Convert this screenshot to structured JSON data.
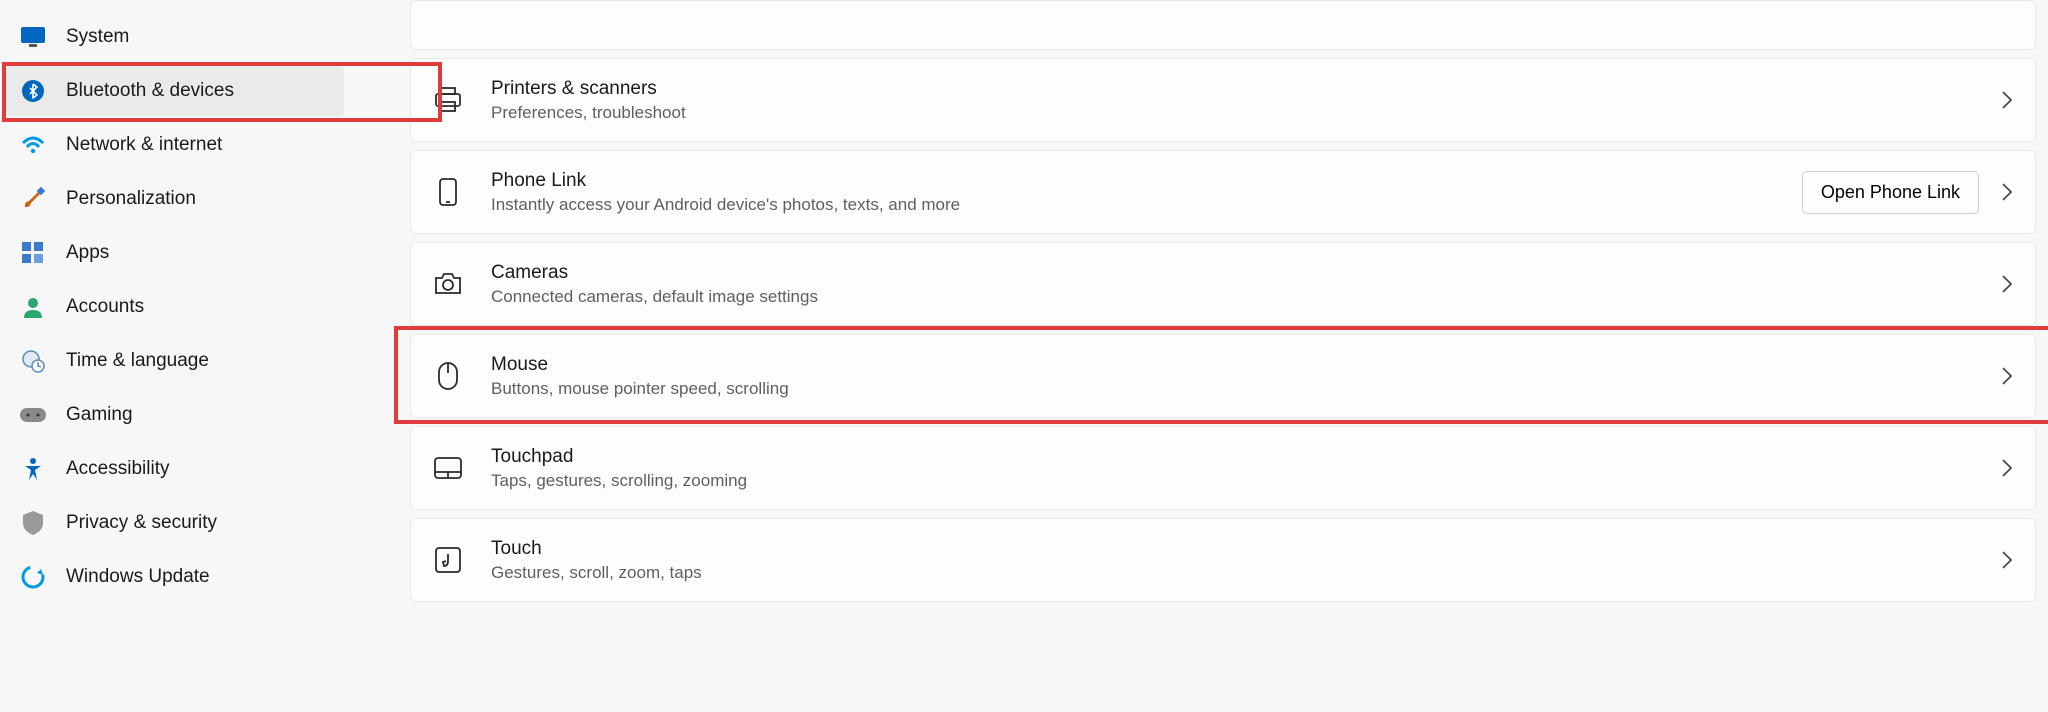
{
  "sidebar": {
    "items": [
      {
        "label": "System",
        "icon": "system-icon"
      },
      {
        "label": "Bluetooth & devices",
        "icon": "bluetooth-icon",
        "active": true
      },
      {
        "label": "Network & internet",
        "icon": "wifi-icon"
      },
      {
        "label": "Personalization",
        "icon": "brush-icon"
      },
      {
        "label": "Apps",
        "icon": "apps-icon"
      },
      {
        "label": "Accounts",
        "icon": "person-icon"
      },
      {
        "label": "Time & language",
        "icon": "clock-globe-icon"
      },
      {
        "label": "Gaming",
        "icon": "gamepad-icon"
      },
      {
        "label": "Accessibility",
        "icon": "accessibility-icon"
      },
      {
        "label": "Privacy & security",
        "icon": "shield-icon"
      },
      {
        "label": "Windows Update",
        "icon": "update-icon"
      }
    ]
  },
  "settings": [
    {
      "title": "Printers & scanners",
      "sub": "Preferences, troubleshoot",
      "icon": "printer-icon"
    },
    {
      "title": "Phone Link",
      "sub": "Instantly access your Android device's photos, texts, and more",
      "icon": "phone-icon",
      "button": "Open Phone Link"
    },
    {
      "title": "Cameras",
      "sub": "Connected cameras, default image settings",
      "icon": "camera-icon"
    },
    {
      "title": "Mouse",
      "sub": "Buttons, mouse pointer speed, scrolling",
      "icon": "mouse-icon",
      "highlighted": true
    },
    {
      "title": "Touchpad",
      "sub": "Taps, gestures, scrolling, zooming",
      "icon": "touchpad-icon"
    },
    {
      "title": "Touch",
      "sub": "Gestures, scroll, zoom, taps",
      "icon": "touch-icon"
    }
  ],
  "highlights": [
    "sidebar-bluetooth-devices",
    "settings-mouse"
  ]
}
